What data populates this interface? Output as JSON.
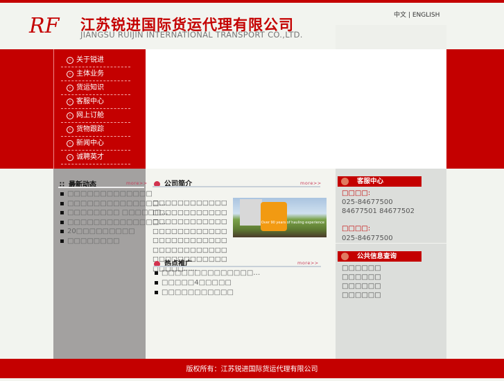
{
  "header": {
    "logo_mark": "RF",
    "company_cn": "江苏锐进国际货运代理有限公司",
    "company_en": "JIANGSU RUIJIN INTERNATIONAL TRANSPORT CO.,LTD.",
    "lang_cn": "中文",
    "lang_sep": "|",
    "lang_en": "ENGLISH"
  },
  "menu": [
    {
      "label": "关于锐进"
    },
    {
      "label": "主体业务"
    },
    {
      "label": "货运知识"
    },
    {
      "label": "客服中心"
    },
    {
      "label": "网上订舱"
    },
    {
      "label": "货物跟踪"
    },
    {
      "label": "新闻中心"
    },
    {
      "label": "诚聘英才"
    }
  ],
  "news": {
    "title": "最新动态",
    "more": "more>>",
    "items": [
      "□□□□□□□□□□□□□",
      "□□□□□□□□□□□□□□…",
      "□□□□□□□□ □□□□□□…",
      "□□□□□□□□□□□□□□…",
      "20□□□□□□□□□",
      "□□□□□□□□"
    ]
  },
  "intro": {
    "title": "公司简介",
    "more": "more>>",
    "text": "□□□□□□□□□□□□□□□□□□□□□□□□□□□□□□□□□□□□□□□□□□□□□□□□□□□□□□□□□□□□□□□□□□□□□□□□□□□□□□□□□□□□□□□□□……",
    "image_caption": "Over 90 years of hauling experience"
  },
  "hot": {
    "title": "热点推广",
    "more": "more>>",
    "items": [
      "□□□□□□□□□□□□□□…",
      "□□□□□4□□□□□",
      "□□□□□□□□□□□"
    ]
  },
  "service": {
    "title": "客服中心",
    "label1": "□□□□:",
    "phone1": "025-84677500 84677501 84677502",
    "label2": "□□□□:",
    "phone2": "025-84677500"
  },
  "public_info": {
    "title": "公共信息查询",
    "items": [
      "□□□□□□",
      "□□□□□□",
      "□□□□□□",
      "□□□□□□"
    ]
  },
  "footer": {
    "copyright": "版权所有：江苏锐进国际货运代理有限公司"
  }
}
